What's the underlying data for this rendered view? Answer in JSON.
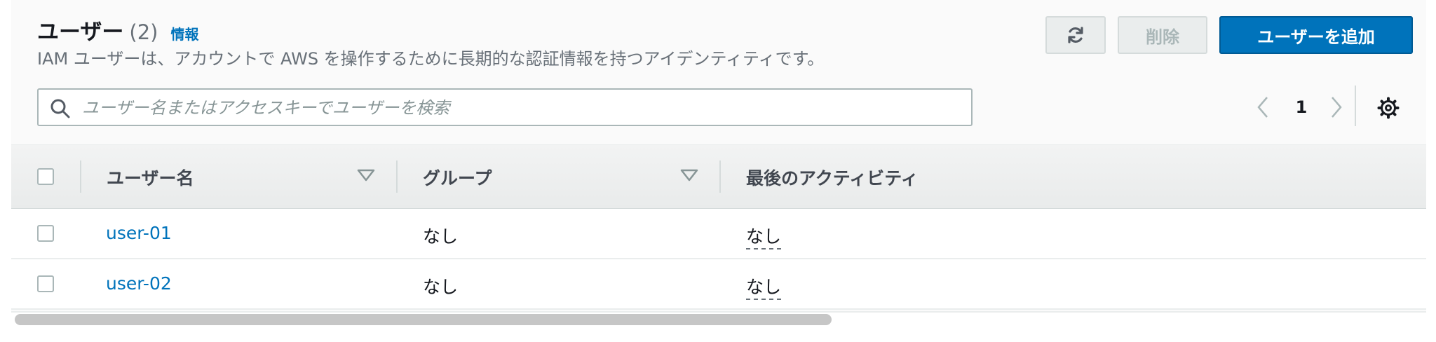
{
  "header": {
    "title": "ユーザー",
    "count": "(2)",
    "info_link": "情報",
    "description": "IAM ユーザーは、アカウントで AWS を操作するために長期的な認証情報を持つアイデンティティです。"
  },
  "actions": {
    "refresh_icon": "refresh-icon",
    "delete_label": "削除",
    "add_user_label": "ユーザーを追加"
  },
  "search": {
    "placeholder": "ユーザー名またはアクセスキーでユーザーを検索",
    "value": ""
  },
  "pagination": {
    "current_page": "1"
  },
  "table": {
    "columns": [
      "ユーザー名",
      "グループ",
      "最後のアクティビティ"
    ],
    "rows": [
      {
        "user_name": "user-01",
        "groups": "なし",
        "last_activity": "なし"
      },
      {
        "user_name": "user-02",
        "groups": "なし",
        "last_activity": "なし"
      }
    ]
  },
  "colors": {
    "accent": "#0073bb",
    "primary_button_border": "#005a94",
    "muted_text": "#687078",
    "header_bg": "#f2f3f3"
  }
}
